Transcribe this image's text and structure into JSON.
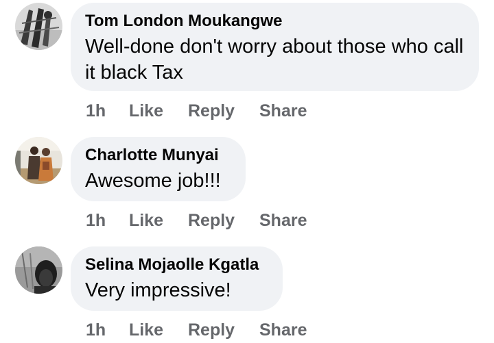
{
  "comments": [
    {
      "author": "Tom London Moukangwe",
      "text": "Well-done don't worry about those who call it black Tax",
      "time": "1h",
      "like_label": "Like",
      "reply_label": "Reply",
      "share_label": "Share"
    },
    {
      "author": "Charlotte Munyai",
      "text": "Awesome job!!!",
      "time": "1h",
      "like_label": "Like",
      "reply_label": "Reply",
      "share_label": "Share"
    },
    {
      "author": "Selina Mojaolle Kgatla",
      "text": "Very impressive!",
      "time": "1h",
      "like_label": "Like",
      "reply_label": "Reply",
      "share_label": "Share"
    }
  ],
  "colors": {
    "bubble_background": "#f0f2f5",
    "action_text": "#65676b",
    "primary_text": "#050505"
  }
}
